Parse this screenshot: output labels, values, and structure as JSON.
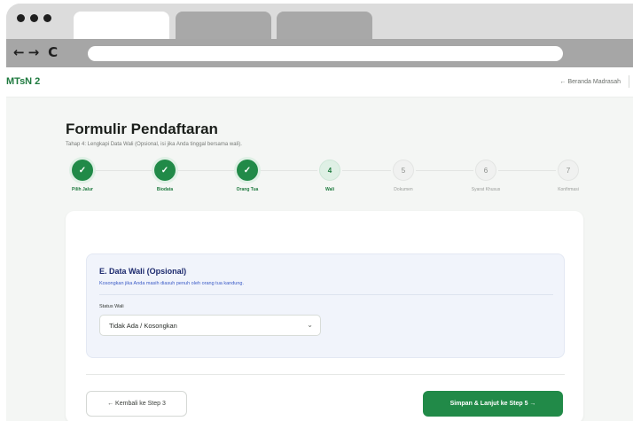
{
  "browser": {
    "nav_back_icon": "arrow-left-icon",
    "nav_forward_icon": "arrow-right-icon",
    "reload_icon": "reload-icon",
    "back_glyph": "←",
    "forward_glyph": "→",
    "reload_glyph": "C"
  },
  "site": {
    "brand": "MTsN 2",
    "home_link": "← Beranda Madrasah"
  },
  "form": {
    "title": "Formulir Pendaftaran",
    "subtitle": "Tahap 4: Lengkapi Data Wali (Opsional, isi jika Anda tinggal bersama wali)."
  },
  "steps": [
    {
      "number": "1",
      "label": "Pilih Jalur",
      "status": "done"
    },
    {
      "number": "2",
      "label": "Biodata",
      "status": "done"
    },
    {
      "number": "3",
      "label": "Orang Tua",
      "status": "done"
    },
    {
      "number": "4",
      "label": "Wali",
      "status": "current"
    },
    {
      "number": "5",
      "label": "Dokumen",
      "status": "pending"
    },
    {
      "number": "6",
      "label": "Syarat Khusus",
      "status": "pending"
    },
    {
      "number": "7",
      "label": "Konfirmasi",
      "status": "pending"
    }
  ],
  "check_glyph": "✓",
  "section": {
    "title": "E. Data Wali (Opsional)",
    "description": "Kosongkan jika Anda masih diasuh penuh oleh orang tua kandung.",
    "status_label": "Status Wali",
    "status_value": "Tidak Ada / Kosongkan",
    "chevron": "⌄"
  },
  "actions": {
    "back_label": "← Kembali ke Step 3",
    "next_label": "Simpan & Lanjut ke Step 5 →"
  },
  "colors": {
    "primary": "#218a48",
    "section_title": "#1d2a6e",
    "section_desc": "#3b5bc7"
  }
}
